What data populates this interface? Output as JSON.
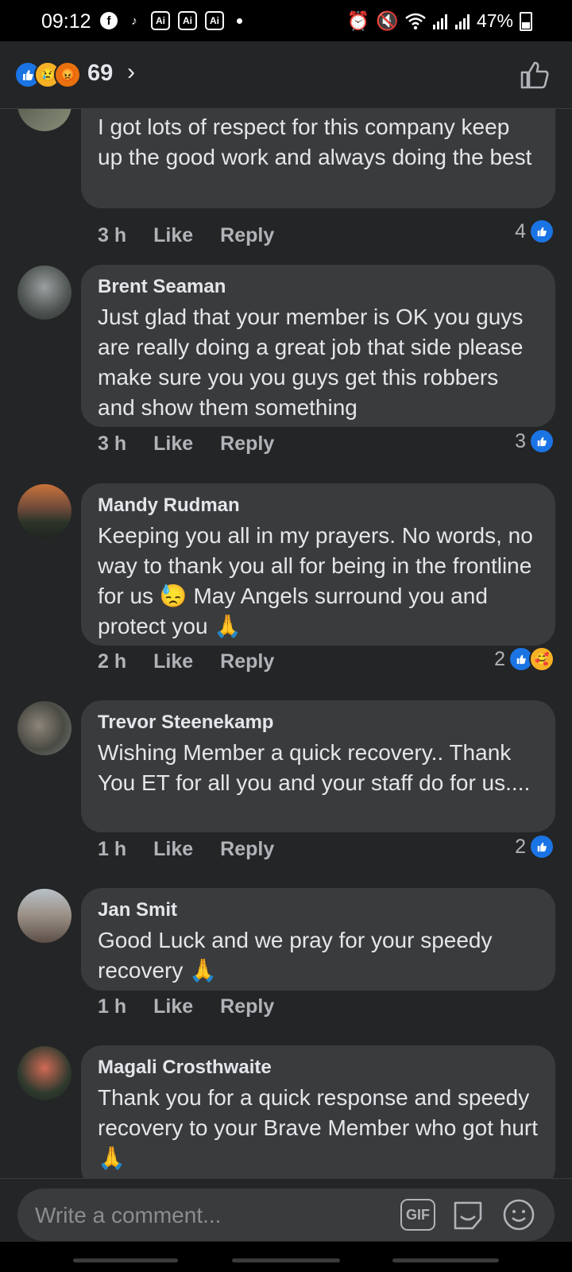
{
  "status_bar": {
    "time": "09:12",
    "ai_label": "Ai",
    "battery": "47%",
    "icons": [
      "facebook-icon",
      "tiktok-icon",
      "ai-icon",
      "ai-icon",
      "ai-icon",
      "alarm-icon",
      "mute-icon",
      "wifi-icon",
      "signal-icon",
      "signal-icon",
      "battery-icon"
    ]
  },
  "header": {
    "reactions": [
      "like",
      "sad",
      "angry"
    ],
    "reaction_count": "69",
    "chevron": "›"
  },
  "colors": {
    "accent": "#1b74e4",
    "bubble": "#3a3b3c",
    "background": "#242526",
    "muted": "#b0b3b8"
  },
  "comments": [
    {
      "author": "",
      "text": "I got lots of respect for this company keep up the good work and always doing the best",
      "time": "3 h",
      "like": "Like",
      "reply": "Reply",
      "reactions": "4"
    },
    {
      "author": "Brent Seaman",
      "text": "Just glad that your member is OK you guys are really doing a great job that side please make sure you you guys get this robbers and show them something",
      "time": "3 h",
      "like": "Like",
      "reply": "Reply",
      "reactions": "3"
    },
    {
      "author": "Mandy Rudman",
      "text": "Keeping you all in my prayers.  No words, no way to thank you all for being in the frontline for us 😓 May Angels surround you and protect you 🙏",
      "time": "2 h",
      "like": "Like",
      "reply": "Reply",
      "reactions": "2"
    },
    {
      "author": "Trevor Steenekamp",
      "text": "Wishing Member a quick recovery.. Thank You ET for all you and your staff do for us....",
      "time": "1 h",
      "like": "Like",
      "reply": "Reply",
      "reactions": "2"
    },
    {
      "author": "Jan Smit",
      "text": "Good Luck and we pray for your speedy recovery 🙏",
      "time": "1 h",
      "like": "Like",
      "reply": "Reply",
      "reactions": ""
    },
    {
      "author": "Magali Crosthwaite",
      "text": "Thank you for a quick response and speedy recovery to  your Brave Member who got hurt 🙏",
      "time": "",
      "like": "",
      "reply": "",
      "reactions": ""
    }
  ],
  "composer": {
    "placeholder": "Write a comment...",
    "gif_label": "GIF"
  }
}
